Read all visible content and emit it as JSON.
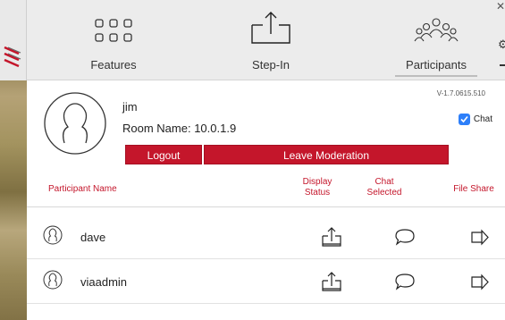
{
  "toolbar": {
    "features_label": "Features",
    "stepin_label": "Step-In",
    "participants_label": "Participants"
  },
  "user": {
    "name": "jim",
    "room": "Room Name: 10.0.1.9",
    "version": "V-1.7.0615.510",
    "chat_label": "Chat",
    "chat_enabled": true
  },
  "buttons": {
    "logout": "Logout",
    "leave_moderation": "Leave Moderation"
  },
  "table": {
    "headers": {
      "name": "Participant Name",
      "display_l1": "Display",
      "display_l2": "Status",
      "chat_l1": "Chat",
      "chat_l2": "Selected",
      "file": "File Share"
    },
    "rows": [
      {
        "name": "dave"
      },
      {
        "name": "viaadmin"
      }
    ]
  },
  "colors": {
    "accent_red": "#c4162b",
    "checkbox_blue": "#2d7ff9",
    "toolbar_bg": "#ececec"
  }
}
